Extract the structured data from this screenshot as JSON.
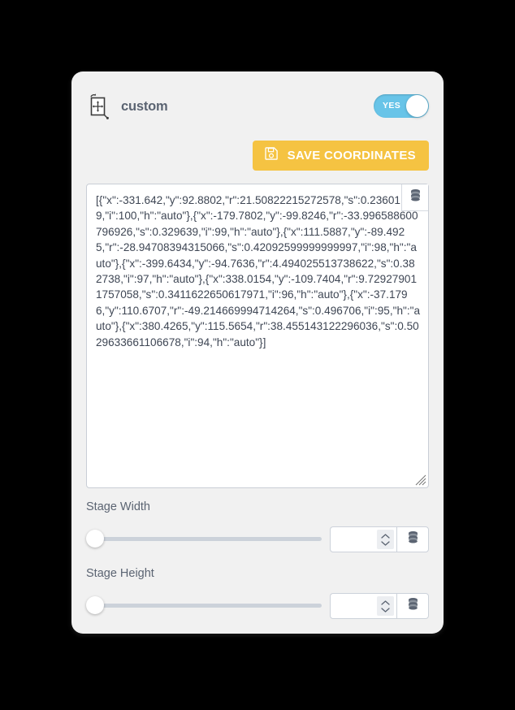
{
  "panel": {
    "header": {
      "icon": "transform-node-icon",
      "title": "custom",
      "toggle": {
        "label": "YES",
        "state": "on",
        "on_color": "#68c4e8"
      }
    },
    "save_button": {
      "icon": "floppy-save-icon",
      "label": "SAVE COORDINATES",
      "color": "#f5c342"
    },
    "coordinates_field": {
      "value": "[{\"x\":-331.642,\"y\":92.8802,\"r\":21.50822215272578,\"s\":0.236019,\"i\":100,\"h\":\"auto\"},{\"x\":-179.7802,\"y\":-99.8246,\"r\":-33.996588600796926,\"s\":0.329639,\"i\":99,\"h\":\"auto\"},{\"x\":111.5887,\"y\":-89.4925,\"r\":-28.94708394315066,\"s\":0.42092599999999997,\"i\":98,\"h\":\"auto\"},{\"x\":-399.6434,\"y\":-94.7636,\"r\":4.494025513738622,\"s\":0.382738,\"i\":97,\"h\":\"auto\"},{\"x\":338.0154,\"y\":-109.7404,\"r\":9.729279011757058,\"s\":0.3411622650617971,\"i\":96,\"h\":\"auto\"},{\"x\":-37.1796,\"y\":110.6707,\"r\":-49.214669994714264,\"s\":0.496706,\"i\":95,\"h\":\"auto\"},{\"x\":380.4265,\"y\":115.5654,\"r\":38.455143122296036,\"s\":0.5029633661106678,\"i\":94,\"h\":\"auto\"}]",
      "placeholder": "",
      "database_icon": "database-icon"
    },
    "sliders": [
      {
        "label": "Stage Width",
        "value": "",
        "placeholder": "",
        "position_percent": 0,
        "spinner_icon": "spinner-updown-icon",
        "database_icon": "database-icon"
      },
      {
        "label": "Stage Height",
        "value": "",
        "placeholder": "",
        "position_percent": 0,
        "spinner_icon": "spinner-updown-icon",
        "database_icon": "database-icon"
      }
    ]
  }
}
